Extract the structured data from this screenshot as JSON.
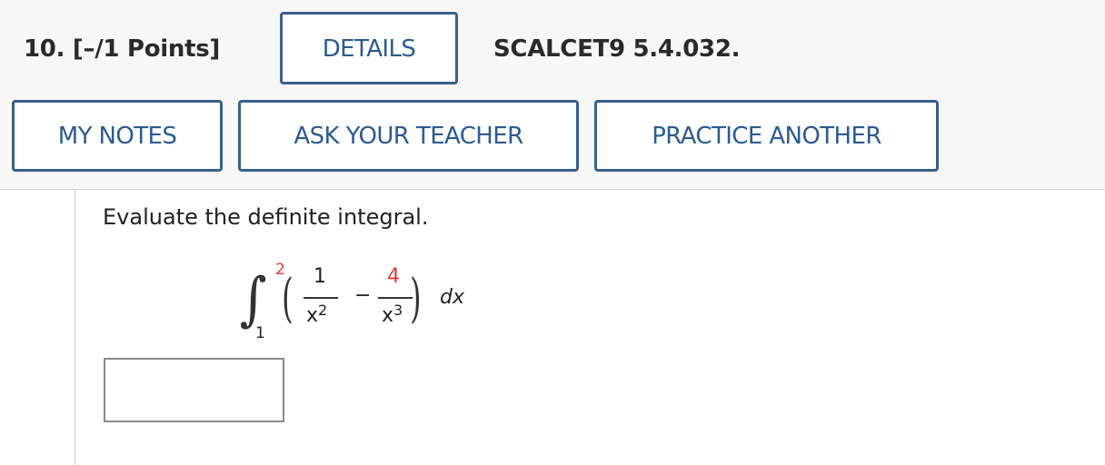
{
  "question": {
    "number_points": "10.  [–/1 Points]",
    "details_label": "DETAILS",
    "reference": "SCALCET9 5.4.032."
  },
  "toolbar": {
    "my_notes_label": "MY NOTES",
    "ask_teacher_label": "ASK YOUR TEACHER",
    "practice_label": "PRACTICE ANOTHER"
  },
  "problem": {
    "prompt": "Evaluate the definite integral.",
    "integral": {
      "upper_limit": "2",
      "lower_limit": "1",
      "term1_numerator": "1",
      "term1_denominator_base": "x",
      "term1_denominator_exp": "2",
      "operator": "−",
      "term2_numerator": "4",
      "term2_denominator_base": "x",
      "term2_denominator_exp": "3",
      "differential": "dx"
    },
    "answer_value": ""
  },
  "colors": {
    "button_border": "#3a5f8c",
    "button_text": "#2c5b91",
    "highlight_red": "#e03a3a",
    "header_bg": "#f7f7f7"
  }
}
